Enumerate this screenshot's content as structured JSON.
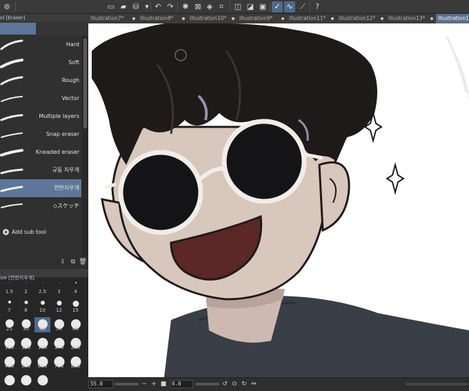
{
  "toolbar": {
    "icons": [
      "app-menu-icon",
      "new-icon",
      "open-icon",
      "save-icon",
      "print-icon",
      "dropdown-icon",
      "undo-icon",
      "redo-icon",
      "loading-icon",
      "clear-icon",
      "fill-icon",
      "transform-icon",
      "select-all-icon",
      "deselect-icon",
      "invert-selection-icon",
      "grid-icon",
      "stabilize-icon",
      "smooth-icon",
      "ruler-icon",
      "help-icon"
    ]
  },
  "tool_panel": {
    "tab_label": "ol [Eraser]",
    "subtools": [
      {
        "label": "Hard",
        "selected": false
      },
      {
        "label": "Soft",
        "selected": false
      },
      {
        "label": "Rough",
        "selected": false
      },
      {
        "label": "Vector",
        "selected": false
      },
      {
        "label": "Multiple layers",
        "selected": false
      },
      {
        "label": "Snap eraser",
        "selected": false
      },
      {
        "label": "Kneaded eraser",
        "selected": false
      },
      {
        "label": "규동 지우개",
        "selected": false
      },
      {
        "label": "연한지우개",
        "selected": true
      },
      {
        "label": "◇スケッチ",
        "selected": false
      }
    ],
    "add_subtool_label": "Add sub tool"
  },
  "brush_size": {
    "tab_label": "ize [연한지우개]",
    "sizes": [
      "1.5",
      "2",
      "2.5",
      "3",
      "4",
      "7",
      "8",
      "10",
      "12",
      "15",
      "25",
      "30",
      "40",
      "50",
      "60",
      "100",
      "120",
      "150",
      "170",
      "200",
      "400",
      "500",
      "600",
      "700",
      "800",
      "",
      "",
      ""
    ],
    "selected": "40"
  },
  "doc_tabs": [
    {
      "label": "Illustration7*",
      "active": false
    },
    {
      "label": "Illustration8*",
      "active": false
    },
    {
      "label": "Illustration10*",
      "active": false
    },
    {
      "label": "Illustration9*",
      "active": false
    },
    {
      "label": "Illustration11*",
      "active": false
    },
    {
      "label": "Illustration12*",
      "active": false
    },
    {
      "label": "Illustration13*",
      "active": false
    },
    {
      "label": "Illustration14",
      "active": true
    }
  ],
  "status": {
    "zoom": "55.0",
    "rotation": "0.0"
  },
  "colors": {
    "accent": "#5e7699",
    "hair": "#1f1a1a",
    "skin": "#d8c7bd",
    "sweater": "#3a3e47",
    "mouth": "#5b2727",
    "glasses_frame": "#f2ede8"
  }
}
